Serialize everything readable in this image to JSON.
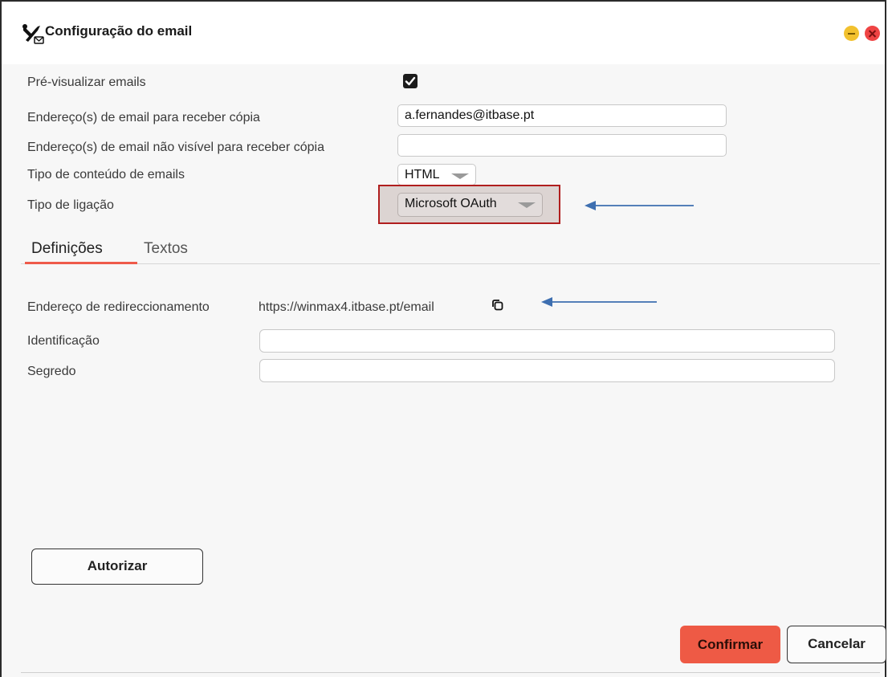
{
  "window": {
    "title": "Configuração do email",
    "title_icon": "tools-email-icon"
  },
  "form": {
    "preview_label": "Pré-visualizar emails",
    "preview_checked": true,
    "cc_label": "Endereço(s) de email para receber cópia",
    "cc_value": "a.fernandes@itbase.pt",
    "bcc_label": "Endereço(s) de email não visível para receber cópia",
    "bcc_value": "",
    "content_type_label": "Tipo de conteúdo de emails",
    "content_type_value": "HTML",
    "connection_label": "Tipo de ligação",
    "connection_value": "Microsoft OAuth"
  },
  "tabs": [
    {
      "label": "Definições",
      "active": true
    },
    {
      "label": "Textos",
      "active": false
    }
  ],
  "settings": {
    "redirect_label": "Endereço de redireccionamento",
    "redirect_url": "https://winmax4.itbase.pt/email",
    "id_label": "Identificação",
    "id_value": "",
    "secret_label": "Segredo",
    "secret_value": ""
  },
  "buttons": {
    "authorize": "Autorizar",
    "confirm": "Confirmar",
    "cancel": "Cancelar"
  },
  "colors": {
    "accent": "#ee5a45",
    "annotation_arrow": "#3e6fb0",
    "highlight_border": "#b01e1e"
  }
}
